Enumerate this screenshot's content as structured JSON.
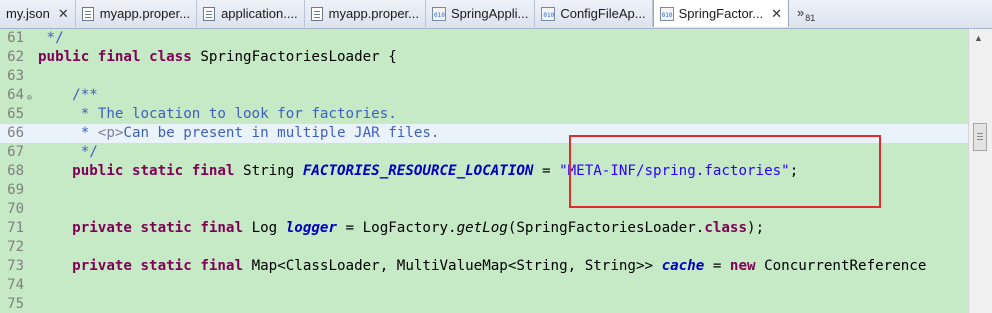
{
  "tabs": [
    {
      "label": "my.json",
      "icon": "json-file-icon",
      "kind": "file"
    },
    {
      "label": "myapp.proper...",
      "icon": "properties-file-icon",
      "kind": "file"
    },
    {
      "label": "application....",
      "icon": "properties-file-icon",
      "kind": "file"
    },
    {
      "label": "myapp.proper...",
      "icon": "properties-file-icon",
      "kind": "file"
    },
    {
      "label": "SpringAppli...",
      "icon": "class-file-icon",
      "kind": "class"
    },
    {
      "label": "ConfigFileAp...",
      "icon": "class-file-icon",
      "kind": "class"
    },
    {
      "label": "SpringFactor...",
      "icon": "class-file-icon",
      "kind": "class",
      "active": true
    }
  ],
  "close_glyph": "✕",
  "overflow": {
    "glyph": "»",
    "count": "81"
  },
  "editor": {
    "lines": [
      {
        "num": "61",
        "text": " */"
      },
      {
        "num": "62",
        "text": "public final class SpringFactoriesLoader {"
      },
      {
        "num": "63",
        "text": ""
      },
      {
        "num": "64",
        "text": "    /**",
        "fold": "⊖"
      },
      {
        "num": "65",
        "text": "     * The location to look for factories."
      },
      {
        "num": "66",
        "text": "     * <p>Can be present in multiple JAR files."
      },
      {
        "num": "67",
        "text": "     */"
      },
      {
        "num": "68",
        "text": "    public static final String FACTORIES_RESOURCE_LOCATION = \"META-INF/spring.factories\";"
      },
      {
        "num": "69",
        "text": ""
      },
      {
        "num": "70",
        "text": ""
      },
      {
        "num": "71",
        "text": "    private static final Log logger = LogFactory.getLog(SpringFactoriesLoader.class);"
      },
      {
        "num": "72",
        "text": ""
      },
      {
        "num": "73",
        "text": "    private static final Map<ClassLoader, MultiValueMap<String, String>> cache = new ConcurrentReference"
      },
      {
        "num": "74",
        "text": ""
      },
      {
        "num": "75",
        "text": ""
      }
    ],
    "current_line_index": 5,
    "highlight_color": "#e22c2c",
    "background_color": "#c6e9c6"
  },
  "scrollbar": {
    "up_glyph": "▲"
  }
}
